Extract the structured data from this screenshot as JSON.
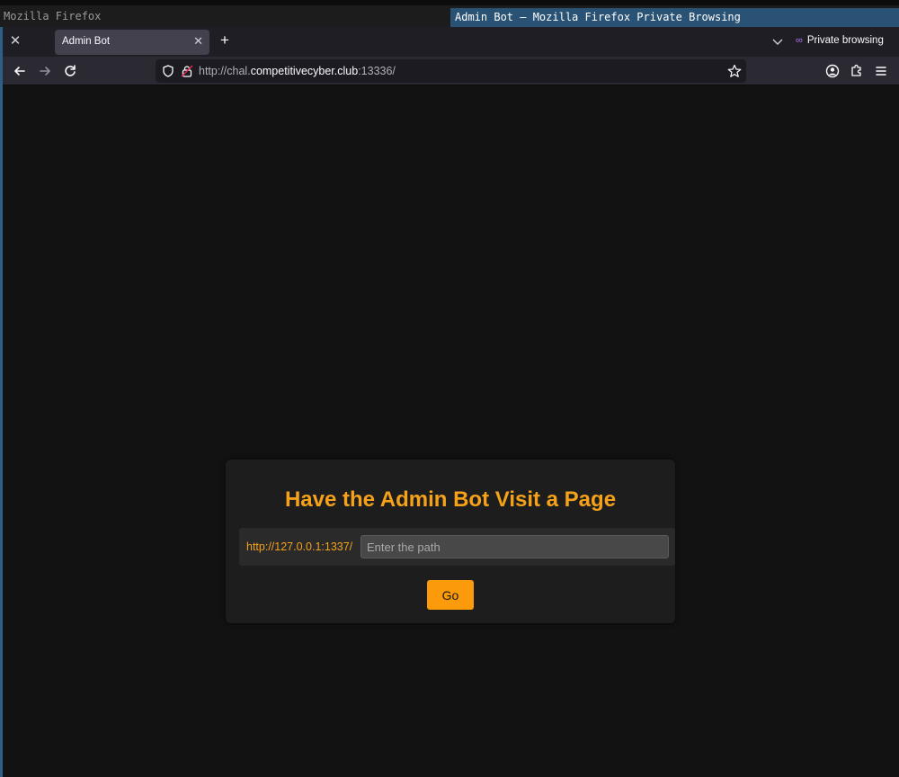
{
  "wm": {
    "left_title": "Mozilla Firefox",
    "active_title": "Admin Bot — Mozilla Firefox Private Browsing"
  },
  "browser": {
    "tab_title": "Admin Bot",
    "private_label": "Private browsing",
    "url_prefix": "http://chal.",
    "url_domain": "competitivecyber.club",
    "url_port_path": ":13336/"
  },
  "page": {
    "heading": "Have the Admin Bot Visit a Page",
    "host_prefix": "http://127.0.0.1:1337/",
    "path_placeholder": "Enter the path",
    "go_label": "Go"
  },
  "colors": {
    "accent": "#f5a21a",
    "button": "#fb9a0a",
    "background": "#121212",
    "card": "#1d1d1d"
  }
}
